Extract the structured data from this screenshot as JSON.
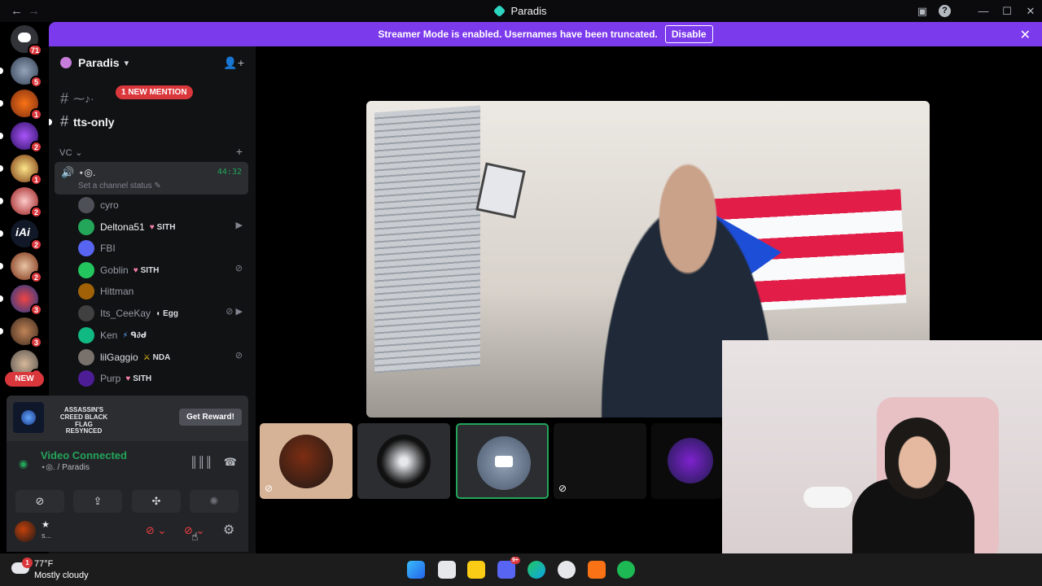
{
  "window": {
    "title": "Paradis",
    "back": "←",
    "forward": "→"
  },
  "banner": {
    "message": "Streamer Mode is enabled. Usernames have been truncated.",
    "disable_label": "Disable",
    "close": "✕"
  },
  "rail": {
    "badges": [
      "71",
      "5",
      "1",
      "2",
      "1",
      "2",
      "2",
      "2",
      "3",
      "3",
      "1"
    ],
    "new_label": "NEW"
  },
  "guild": {
    "name": "Paradis",
    "chevron": "⌄"
  },
  "channels": {
    "channel1_name": "⁓♪·",
    "mention_label": "1 NEW MENTION",
    "channel2_name": "tts-only",
    "category": "VC ⌄",
    "category_add": "+"
  },
  "voice_channel": {
    "name": "⋆◎.",
    "timer": "44:32",
    "status": "Set a channel status ✎"
  },
  "members": [
    {
      "name": "cyro",
      "tag": "",
      "icons": ""
    },
    {
      "name": "Deltona51",
      "tag": "SITH",
      "icons": "▶"
    },
    {
      "name": "FBI",
      "tag": "",
      "icons": ""
    },
    {
      "name": "Goblin",
      "tag": "SITH",
      "icons": "⊘"
    },
    {
      "name": "Hittman",
      "tag": "",
      "icons": ""
    },
    {
      "name": "Its_CeeKay",
      "tag": "Egg",
      "icons": "⊘ ▶"
    },
    {
      "name": "Ken",
      "tag": "ᑫ∂ᑯ",
      "icons": ""
    },
    {
      "name": "lilGaggio",
      "tag": "NDA",
      "icons": "⊘"
    },
    {
      "name": "Purp",
      "tag": "SITH",
      "icons": ""
    }
  ],
  "promo": {
    "game": "ASSASSIN'S CREED BLACK FLAG RESYNCED",
    "button": "Get Reward!"
  },
  "voice_panel": {
    "title": "Video Connected",
    "subtitle": "⋆◎. / Paradis"
  },
  "user": {
    "name": "★",
    "status": "s..."
  },
  "taskbar": {
    "temp": "77°F",
    "condition": "Mostly cloudy",
    "weather_badge": "1",
    "discord_badge": "9+"
  },
  "colors": {
    "accent": "#7c3aed",
    "green": "#23a55a",
    "red": "#da373c"
  }
}
